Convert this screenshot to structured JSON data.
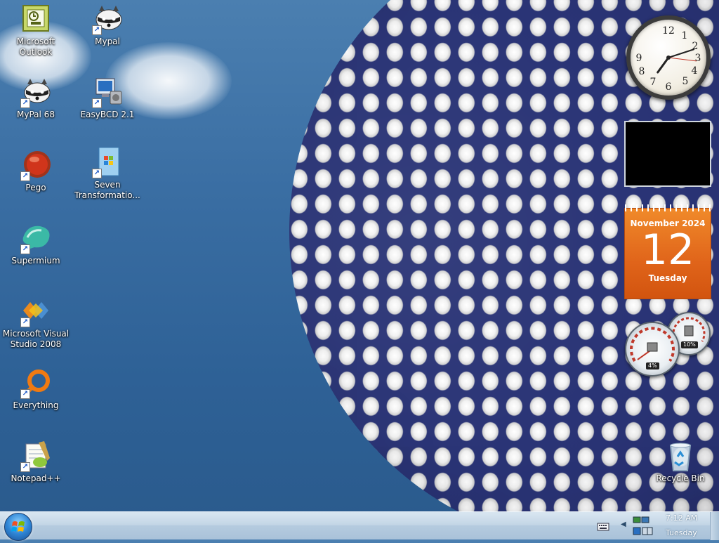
{
  "desktop": {
    "icons": [
      {
        "label": "Microsoft Outlook",
        "icon": "outlook-icon"
      },
      {
        "label": "Mypal",
        "icon": "raccoon-icon"
      },
      {
        "label": "MyPal 68",
        "icon": "raccoon-icon"
      },
      {
        "label": "EasyBCD 2.1",
        "icon": "computer-icon"
      },
      {
        "label": "Pego",
        "icon": "red-orb-icon"
      },
      {
        "label": "Seven Transformatio...",
        "icon": "windows-box-icon"
      },
      {
        "label": "Supermium",
        "icon": "supermium-icon"
      },
      {
        "label": "Microsoft Visual Studio 2008",
        "icon": "visual-studio-icon"
      },
      {
        "label": "Everything",
        "icon": "magnifier-icon"
      },
      {
        "label": "Notepad++",
        "icon": "notepad-icon"
      },
      {
        "label": "Recycle Bin",
        "icon": "recycle-bin-icon"
      }
    ]
  },
  "gadgets": {
    "clock": {
      "hour": 7,
      "minute": 12
    },
    "calendar": {
      "month": "November 2024",
      "day": "12",
      "weekday": "Tuesday"
    },
    "cpu_meter": {
      "cpu": "4%",
      "memory": "10%"
    }
  },
  "taskbar": {
    "time": "7:12 AM",
    "day": "Tuesday"
  }
}
